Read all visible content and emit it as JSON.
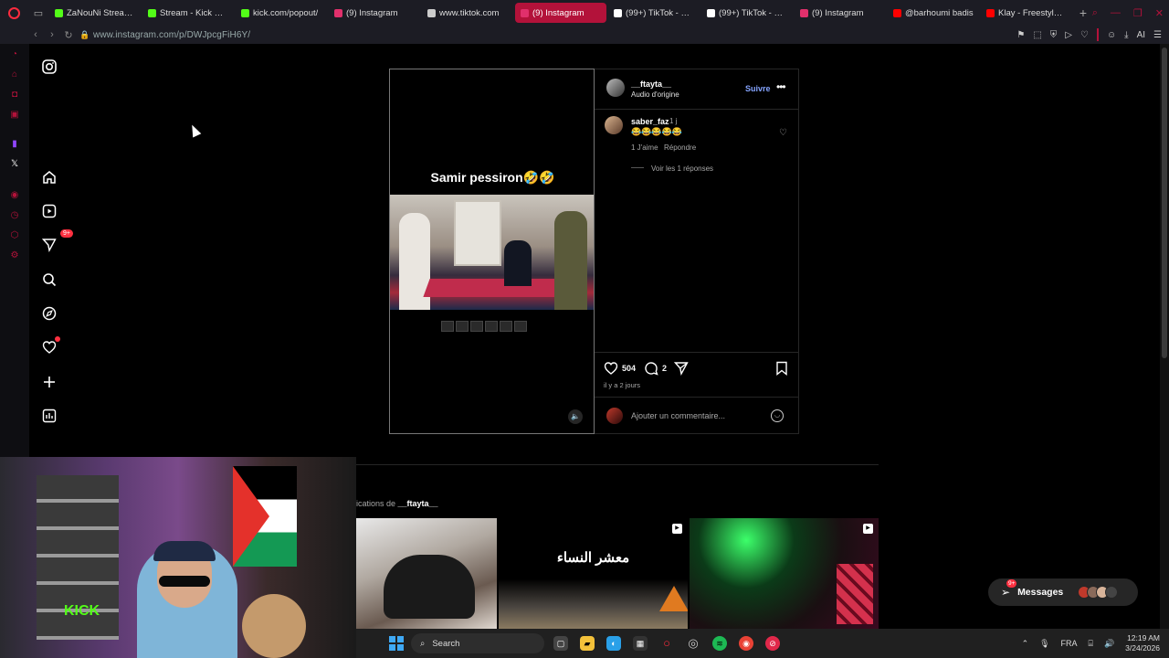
{
  "browser": {
    "tabs": [
      {
        "title": "ZaNouNi Stream -",
        "color": "#53fc18"
      },
      {
        "title": "Stream - Kick Das",
        "color": "#53fc18"
      },
      {
        "title": "kick.com/popout/",
        "color": "#53fc18"
      },
      {
        "title": "(9) Instagram",
        "color": "#e1306c"
      },
      {
        "title": "www.tiktok.com",
        "color": "#cccccc"
      },
      {
        "title": "(9) Instagram",
        "color": "#e1306c",
        "active": true
      },
      {
        "title": "(99+) TikTok - Mak",
        "color": "#ffffff"
      },
      {
        "title": "(99+) TikTok - Mak",
        "color": "#ffffff"
      },
      {
        "title": "(9) Instagram",
        "color": "#e1306c"
      },
      {
        "title": "@barhoumi badis",
        "color": "#ff0000"
      },
      {
        "title": "Klay - Freestyle Ya",
        "color": "#ff0000"
      }
    ],
    "url": "www.instagram.com/p/DWJpcgFiH6Y/",
    "toolbar_ai": "AI",
    "accent": "#b3123a"
  },
  "nav": {
    "notifications_badge": "9+"
  },
  "post": {
    "reel_caption": "Samir pessiron🤣🤣",
    "author": "__ftayta__",
    "audio": "Audio d'origine",
    "follow_label": "Suivre",
    "comment": {
      "user": "saber_faz",
      "time": "1 j",
      "text": "😂😂😂😂😂",
      "likes": "1 J'aime",
      "reply_label": "Répondre",
      "view_replies": "Voir les 1 réponses"
    },
    "like_count": "504",
    "comment_count": "2",
    "posted_ago": "il y a 2 jours",
    "add_comment_placeholder": "Ajouter un commentaire..."
  },
  "more_posts": {
    "prefix": "ications de ",
    "user": "__ftayta__",
    "thumb2_text": "معشر النساء"
  },
  "messages": {
    "label": "Messages",
    "badge": "9+"
  },
  "taskbar": {
    "search_label": "Search",
    "language": "FRA",
    "time": "12:19 AM",
    "date": "3/24/2026"
  }
}
